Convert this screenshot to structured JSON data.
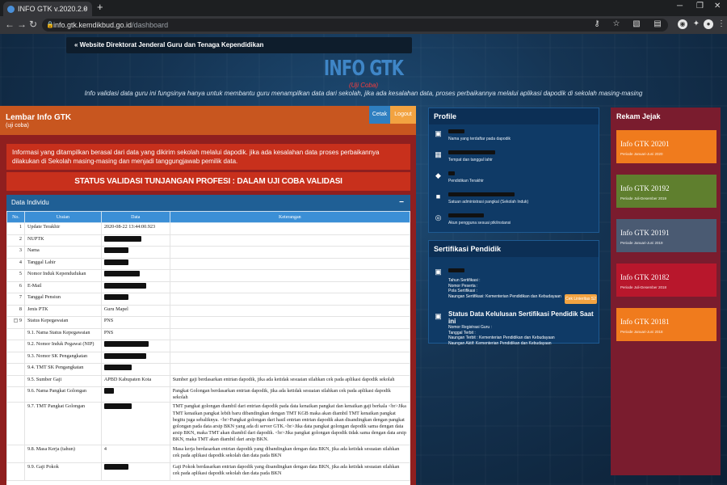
{
  "browser": {
    "tab_title": "INFO GTK v.2020.2.0",
    "tab_close": "×",
    "new_tab": "+",
    "url_host": "info.gtk.kemdikbud.go.id",
    "url_path": "/dashboard"
  },
  "page": {
    "top_link": "« Website Direktorat Jenderal Guru dan Tenaga Kependidikan",
    "title": "INFO GTK",
    "subtitle": "(Uji Coba)",
    "description": "Info validasi data guru ini fungsinya hanya untuk membantu guru menampilkan data dari sekolah, jika ada kesalahan data, proses perbaikannya melalui aplikasi dapodik di sekolah masing-masing"
  },
  "lembar": {
    "title": "Lembar Info GTK",
    "subtitle": "(uji coba)",
    "cetak": "Cetak",
    "logout": "Logout",
    "notice": "Informasi yang ditampilkan berasal dari data yang dikirim sekolah melalui dapodik. jika ada kesalahan data proses perbaikannya dilakukan di Sekolah masing-masing dan menjadi tanggungjawab pemilik data.",
    "status": "STATUS VALIDASI TUNJANGAN PROFESI : DALAM UJI COBA VALIDASI",
    "data_individu": "Data Individu",
    "collapse": "−",
    "columns": [
      "No.",
      "Uraian",
      "Data",
      "Keterangan"
    ],
    "rows": [
      {
        "no": "1",
        "uraian": "Update Terakhir",
        "data": "2020-08-22 13:44:00.923",
        "ket": "",
        "redact": 0
      },
      {
        "no": "2",
        "uraian": "NUPTK",
        "data": "",
        "ket": "",
        "redact": 46
      },
      {
        "no": "3",
        "uraian": "Nama",
        "data": "",
        "ket": "",
        "redact": 30
      },
      {
        "no": "4",
        "uraian": "Tanggal Lahir",
        "data": "",
        "ket": "",
        "redact": 30
      },
      {
        "no": "5",
        "uraian": "Nomor Induk Kependudukan",
        "data": "",
        "ket": "",
        "redact": 44
      },
      {
        "no": "6",
        "uraian": "E-Mail",
        "data": "",
        "ket": "",
        "redact": 52
      },
      {
        "no": "7",
        "uraian": "Tanggal Pensiun",
        "data": "",
        "ket": "",
        "redact": 30
      },
      {
        "no": "8",
        "uraian": "Jenis PTK",
        "data": "Guru Mapel",
        "ket": "",
        "redact": 0
      },
      {
        "no": "9",
        "uraian": "Status Kepegawaian",
        "data": "PNS",
        "ket": "",
        "redact": 0,
        "expand": true
      },
      {
        "no": "",
        "uraian": "9.1. Nama Status Kepegawaian",
        "data": "PNS",
        "ket": "",
        "redact": 0
      },
      {
        "no": "",
        "uraian": "9.2. Nomor Induk Pegawai (NIP)",
        "data": "",
        "ket": "",
        "redact": 55
      },
      {
        "no": "",
        "uraian": "9.3. Nomor SK Pengangkatan",
        "data": "",
        "ket": "",
        "redact": 52
      },
      {
        "no": "",
        "uraian": "9.4. TMT SK Pengangkatan",
        "data": "",
        "ket": "",
        "redact": 34
      },
      {
        "no": "",
        "uraian": "9.5. Sumber Gaji",
        "data": "APBD Kabupaten Kota",
        "ket": "Sumber gaji berdasarkan entrian dapodik, jika ada ketidak sesuaian silahkan cek pada aplikasi dapodik sekolah",
        "redact": 0
      },
      {
        "no": "",
        "uraian": "9.6. Nama Pangkat Golongan",
        "data": "",
        "ket": "Pangkat Golongan berdasarkan entrian dapodik, jika ada ketidak sesuaian silahkan cek pada aplikasi dapodik sekolah",
        "redact": 12
      },
      {
        "no": "",
        "uraian": "9.7. TMT Pangkat Golongan",
        "data": "",
        "ket": "TMT pangkat golongan diambil dari entrian dapodik pada data kenaikan pangkat dan kenaikan gaji berkala <br>Jika TMT kenaikan pangkat lebih baru dibandingkan dengan TMT KGB maka akan diambil TMT kenaikan pangkat begitu juga sebaliknya. <br>Pangkat golongan dari hasil entrian entrian dapodik akan disandingkan dengan pangkat golongan pada data arsip BKN yang ada di server GTK.<br>Jika data pangkat golongan dapodik sama dengan data arsip BKN, maka TMT akan diambil dari dapodik. <br>Jika pangkat golongan dapodik tidak sama dengan data arsip BKN, maka TMT akan diambil dari arsip BKN.",
        "redact": 34,
        "tall": 44
      },
      {
        "no": "",
        "uraian": "9.8. Masa Kerja (tahun)",
        "data": "4",
        "ket": "Masa kerja berdasarkan entrian dapodik yang dibandingkan dengan data BKN, jika ada ketidak sesuaian silahkan cek pada aplikasi dapodik sekolah dan data pada BKN",
        "redact": 0,
        "tall": 22
      },
      {
        "no": "",
        "uraian": "9.9. Gaji Pokok",
        "data": "",
        "ket": "Gaji Pokok berdasarkan entrian dapodik yang disandingkan dengan data BKN, jika ada ketidak sesuaian silahkan cek pada aplikasi dapodik sekolah dan data pada BKN",
        "redact": 30,
        "tall": 22
      }
    ]
  },
  "profile": {
    "title": "Profile",
    "items": [
      {
        "icon": "id-card-icon",
        "glyph": "▣",
        "label": "Nama yang terdaftar pada dapodik",
        "redact": 20
      },
      {
        "icon": "calendar-icon",
        "glyph": "▦",
        "label": "Tempat dan tanggal lahir",
        "redact": 58
      },
      {
        "icon": "graduation-cap-icon",
        "glyph": "◆",
        "label": "Pendidikan Terakhir",
        "redact": 8
      },
      {
        "icon": "briefcase-icon",
        "glyph": "■",
        "label": "Satuan administrasi pangkal (Sekolah Induk)",
        "redact": 82
      },
      {
        "icon": "fingerprint-icon",
        "glyph": "◎",
        "label": "Akun pengguna sesuai ptk/instansi",
        "redact": 44
      }
    ]
  },
  "sertifikasi": {
    "title": "Sertifikasi Pendidik",
    "lines": [
      "Tahun Sertifikasi :",
      "Nomor Peserta :",
      "Pola Sertifikasi :",
      "Naungan Sertifikasi: Kementerian Pendidikan dan Kebudayaan"
    ],
    "cek_button": "Cek Linieritas S2",
    "status_title": "Status Data Kelulusan Sertifikasi Pendidik Saat ini",
    "status_lines": [
      "Nomor Registrasi Guru :",
      "Tanggal Terbit :",
      "Naungan Terbit : Kementerian Pendidikan dan Kebudayaan",
      "Naungan Aktif: Kementerian Pendidikan dan Kebudayaan"
    ]
  },
  "rekam": {
    "title": "Rekam Jejak",
    "cards": [
      {
        "title": "Info GTK 20201",
        "period": "Periode Januari-Juni 2020",
        "color": "#f07b1d"
      },
      {
        "title": "Info GTK 20192",
        "period": "Periode Juli-Desember 2019",
        "color": "#5f7f2e"
      },
      {
        "title": "Info GTK 20191",
        "period": "Periode Januari-Juni 2019",
        "color": "#4a5a72"
      },
      {
        "title": "Info GTK 20182",
        "period": "Periode Juli-Desember 2018",
        "color": "#b8172c"
      },
      {
        "title": "Info GTK 20181",
        "period": "Periode Januari-Juni 2018",
        "color": "#f07b1d"
      }
    ]
  }
}
